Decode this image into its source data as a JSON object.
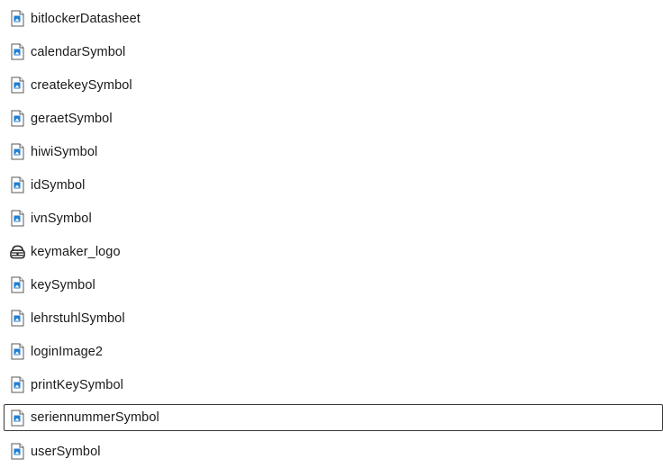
{
  "files": [
    {
      "name": "bitlockerDatasheet",
      "icon": "image-file-icon"
    },
    {
      "name": "calendarSymbol",
      "icon": "image-file-icon"
    },
    {
      "name": "createkeySymbol",
      "icon": "image-file-icon"
    },
    {
      "name": "geraetSymbol",
      "icon": "image-file-icon"
    },
    {
      "name": "hiwiSymbol",
      "icon": "image-file-icon"
    },
    {
      "name": "idSymbol",
      "icon": "image-file-icon"
    },
    {
      "name": "ivnSymbol",
      "icon": "image-file-icon"
    },
    {
      "name": "keymaker_logo",
      "icon": "ico-file-icon"
    },
    {
      "name": "keySymbol",
      "icon": "image-file-icon"
    },
    {
      "name": "lehrstuhlSymbol",
      "icon": "image-file-icon"
    },
    {
      "name": "loginImage2",
      "icon": "image-file-icon"
    },
    {
      "name": "printKeySymbol",
      "icon": "image-file-icon"
    },
    {
      "name": "seriennummerSymbol",
      "icon": "image-file-icon",
      "focused": true
    },
    {
      "name": "userSymbol",
      "icon": "image-file-icon"
    }
  ],
  "colors": {
    "icon_accent": "#1f7fd6",
    "focus_border": "#3a3a3a",
    "text": "#1a1a1a"
  }
}
